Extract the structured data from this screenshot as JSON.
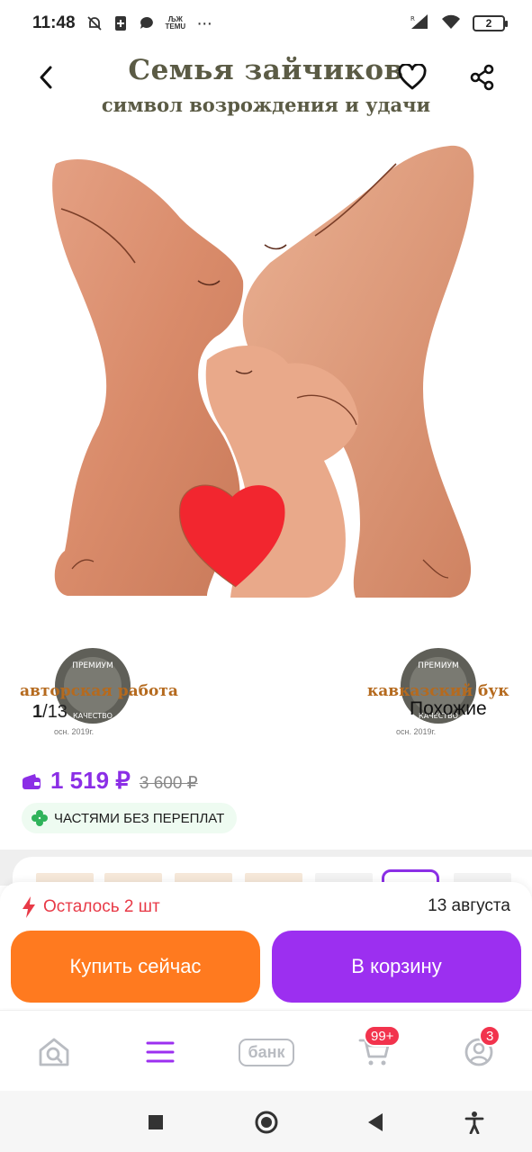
{
  "status_bar": {
    "time": "11:48",
    "notifications": [
      "muted-bell-icon",
      "sim-app-icon",
      "chat-icon",
      "temu-icon",
      "more-dots-icon"
    ],
    "temu_label": "TEMU",
    "more": "···",
    "battery": "2"
  },
  "header": {
    "title": "Семья зайчиков",
    "subtitle": "символ возрождения и удачи"
  },
  "gallery": {
    "current": "1",
    "total": "13",
    "separator": "/",
    "similar_label": "Похожие",
    "stamp_left_label": "авторская работа",
    "stamp_right_label": "кавказский бук",
    "stamp_left_caption": "осн.        2019г.",
    "stamp_right_caption": "осн.        2019г."
  },
  "price": {
    "current": "1 519 ₽",
    "old": "3 600 ₽",
    "split_label": "ЧАСТЯМИ БЕЗ ПЕРЕПЛАТ"
  },
  "purchase": {
    "stock_label": "Осталось 2 шт",
    "delivery_date": "13 августа",
    "buy_now": "Купить сейчас",
    "add_to_cart": "В корзину"
  },
  "bottom_nav": {
    "bank_label": "банк",
    "cart_badge": "99+",
    "profile_badge": "3"
  },
  "colors": {
    "accent_purple": "#9c2ff0",
    "accent_orange": "#ff7a1f",
    "stock_red": "#e83a47",
    "badge_red": "#f2334d",
    "price_purple": "#8b2ee6"
  }
}
